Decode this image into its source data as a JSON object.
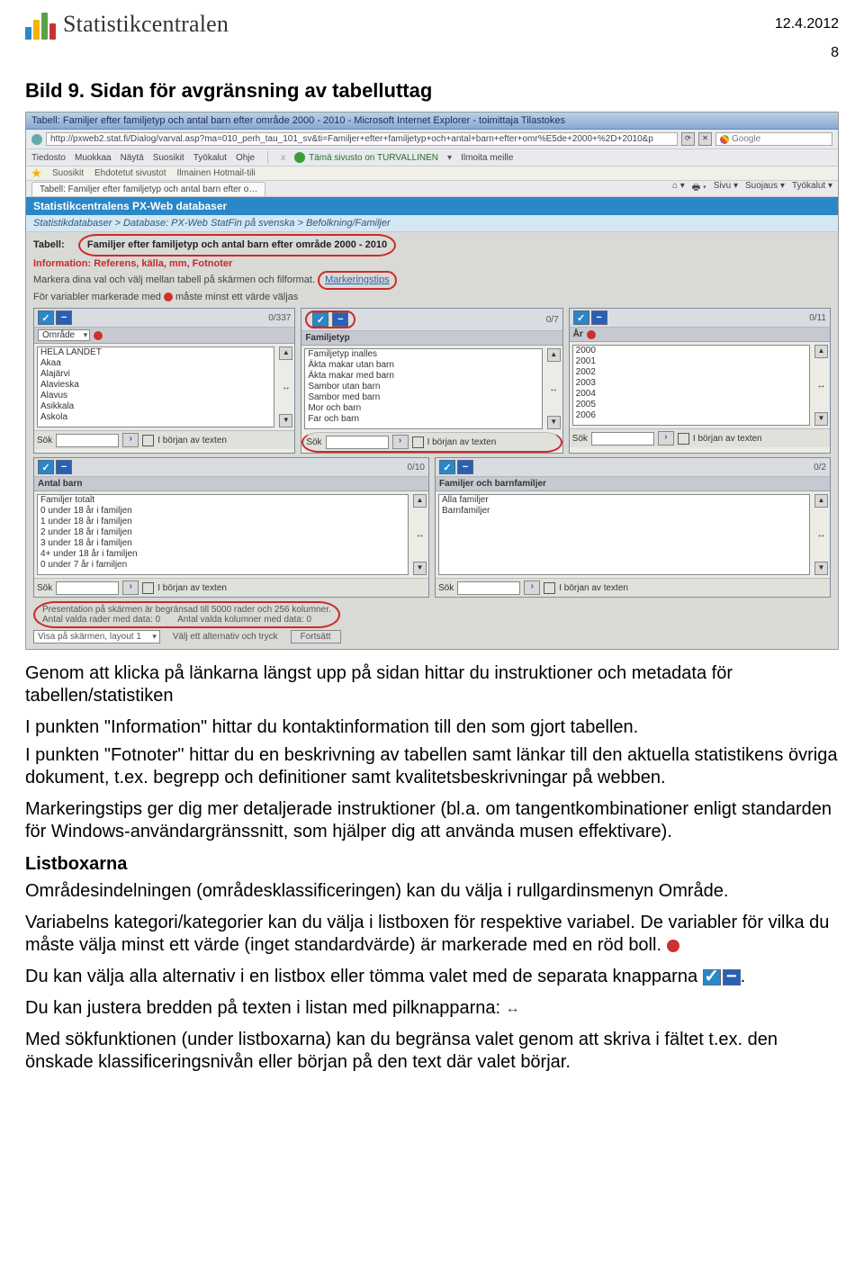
{
  "header": {
    "brand_name": "Statistikcentralen",
    "date": "12.4.2012",
    "page_number": "8"
  },
  "intro": {
    "figure_caption": "Bild 9. Sidan för avgränsning av tabelluttag"
  },
  "screenshot": {
    "window_title": "Tabell: Familjer efter familjetyp och antal barn efter område 2000 - 2010 - Microsoft Internet Explorer - toimittaja Tilastokes",
    "url": "http://pxweb2.stat.fi/Dialog/varval.asp?ma=010_perh_tau_101_sv&ti=Familjer+efter+familjetyp+och+antal+barn+efter+omr%E5de+2000+%2D+2010&p",
    "search_engine": "Google",
    "menu": {
      "tiedosto": "Tiedosto",
      "muokkaa": "Muokkaa",
      "nayta": "Näytä",
      "suosikit": "Suosikit",
      "tyokalut": "Työkalut",
      "ohje": "Ohje",
      "safe_site": "Tämä sivusto on TURVALLINEN",
      "ilmoita": "Ilmoita meille"
    },
    "favbar": {
      "suosikit": "Suosikit",
      "ehdotetut": "Ehdotetut sivustot",
      "hotmail": "Ilmainen Hotmail-tili"
    },
    "tab_label": "Tabell: Familjer efter familjetyp och antal barn efter o…",
    "tools": {
      "sivu": "Sivu",
      "suojaus": "Suojaus",
      "tyokalut": "Työkalut"
    },
    "px": {
      "banner": "Statistikcentralens PX-Web databaser",
      "breadcrumb": "Statistikdatabaser > Database: PX-Web StatFin på svenska > Befolkning/Familjer",
      "tabell_label": "Tabell:",
      "tabell_value": "Familjer efter familjetyp och antal barn efter område 2000 - 2010",
      "info_label": "Information:",
      "info_links": "Referens, källa, mm, Fotnoter",
      "markera_line_a": "Markera dina val och välj mellan tabell på skärmen och filformat.",
      "markeringstips": "Markeringstips",
      "markera_line_b1": "För variabler markerade med",
      "markera_line_b2": "måste minst ett värde väljas"
    },
    "cols3": [
      {
        "count": "0/337",
        "title_label": "Område",
        "has_dropdown": true,
        "dot": true,
        "items": [
          "HELA LANDET",
          "Akaa",
          "Alajärvi",
          "Alavieska",
          "Alavus",
          "Asikkala",
          "Askola"
        ],
        "sok_label": "Sök",
        "begin_label": "I början av texten"
      },
      {
        "count": "0/7",
        "title_label": "Familjetyp",
        "has_dropdown": false,
        "dot": false,
        "items": [
          "Familjetyp inalles",
          "Äkta makar utan barn",
          "Äkta makar med barn",
          "Sambor utan barn",
          "Sambor med barn",
          "Mor och barn",
          "Far och barn"
        ],
        "sok_label": "Sök",
        "begin_label": "I början av texten"
      },
      {
        "count": "0/11",
        "title_label": "År",
        "has_dropdown": false,
        "dot": true,
        "items": [
          "2000",
          "2001",
          "2002",
          "2003",
          "2004",
          "2005",
          "2006"
        ],
        "sok_label": "Sök",
        "begin_label": "I början av texten"
      }
    ],
    "cols2": [
      {
        "count": "0/10",
        "title_label": "Antal barn",
        "items": [
          "Familjer totalt",
          "0 under 18 år i familjen",
          "1 under 18 år i familjen",
          "2 under 18 år i familjen",
          "3 under 18 år i familjen",
          "4+ under 18 år i familjen",
          "0 under 7 år i familjen"
        ],
        "sok_label": "Sök",
        "begin_label": "I början av texten"
      },
      {
        "count": "0/2",
        "title_label": "Familjer och barnfamiljer",
        "items": [
          "Alla familjer",
          "Barnfamiljer"
        ],
        "sok_label": "Sök",
        "begin_label": "I början av texten"
      }
    ],
    "footer": {
      "limit": "Presentation på skärmen är begränsad till 5000 rader och 256 kolumner.",
      "rows": "Antal valda rader med data: 0",
      "cols": "Antal valda kolumner med data: 0",
      "visa_label": "Visa på skärmen, layout 1",
      "valj_label": "Välj ett alternativ och tryck",
      "fortsatt": "Fortsätt"
    }
  },
  "body": {
    "p1": "Genom att klicka på länkarna längst upp på sidan hittar du instruktioner och metadata för tabellen/statistiken",
    "p2": "I punkten \"Information\" hittar du kontaktinformation till den som gjort tabellen.",
    "p3": "I punkten \"Fotnoter\" hittar du en beskrivning av tabellen samt länkar till den aktuella statistikens övriga dokument, t.ex. begrepp och definitioner samt kvalitetsbeskrivningar på webben.",
    "p4": "Markeringstips ger dig mer detaljerade instruktioner (bl.a. om tangentkombinationer enligt standarden för Windows-användargränssnitt, som hjälper dig att använda musen effektivare).",
    "h3": "Listboxarna",
    "p5": "Områdesindelningen (områdesklassificeringen) kan du välja i rullgardinsmenyn Område.",
    "p6": "Variabelns kategori/kategorier kan du välja i listboxen för respektive variabel. De variabler för vilka du måste välja minst ett värde (inget standardvärde) är markerade med en röd boll.",
    "p7_a": "Du kan välja alla alternativ i en listbox eller tömma valet med de separata knapparna",
    "p7_b": ".",
    "p8": "Du kan justera bredden på texten i listan med pilknapparna:",
    "p9": "Med sökfunktionen (under listboxarna) kan du begränsa valet genom att skriva i fältet t.ex. den önskade klassificeringsnivån eller början på den text där valet börjar."
  }
}
